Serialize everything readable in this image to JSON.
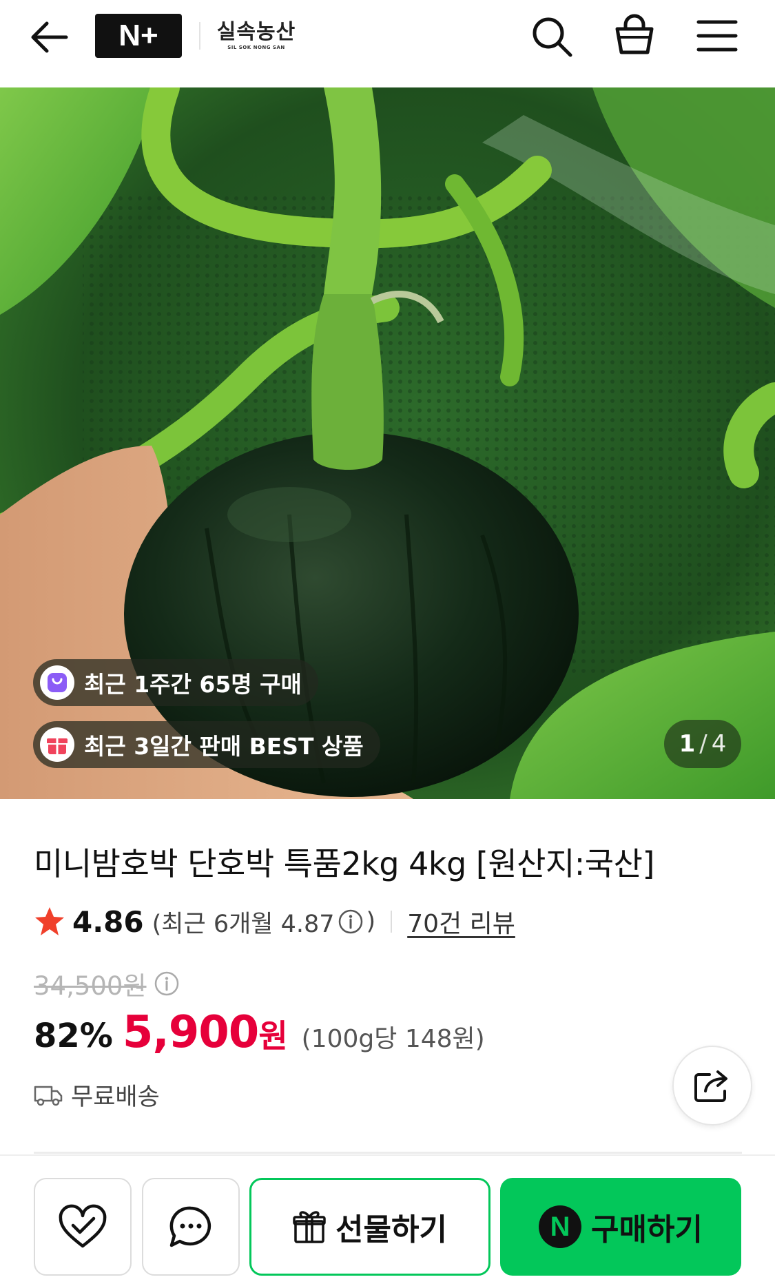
{
  "header": {
    "brand_mark": "N+",
    "store_name": "실속농산",
    "store_name_en": "SIL SOK NONG SAN",
    "icons": [
      "arrow-left-icon",
      "search-icon",
      "shopping-bag-icon",
      "hamburger-menu-icon"
    ]
  },
  "gallery": {
    "badges": [
      {
        "icon": "shopping-bag-icon",
        "text": "최근 1주간 65명 구매"
      },
      {
        "icon": "gift-box-icon",
        "text": "최근 3일간 판매 BEST 상품"
      }
    ],
    "pager_current": "1",
    "pager_separator": "/",
    "pager_total": "4"
  },
  "product": {
    "title": "미니밤호박 단호박 특품2kg 4kg [원산지:국산]",
    "rating": "4.86",
    "rating_recent_prefix": "(최근 6개월 4.87",
    "rating_recent_suffix": ")",
    "review_count": "70건 리뷰",
    "original_price": "34,500원",
    "discount_rate": "82%",
    "price": "5,900",
    "price_currency": "원",
    "unit_price": "(100g당 148원)",
    "shipping": "무료배송"
  },
  "bottom_bar": {
    "gift_label": "선물하기",
    "buy_label": "구매하기",
    "npay_mark": "N"
  },
  "colors": {
    "naver_green": "#03c75a",
    "price_red": "#e6003a",
    "star": "#f0402b",
    "badge_purple": "#8b5cf6",
    "badge_red": "#f0435c"
  }
}
